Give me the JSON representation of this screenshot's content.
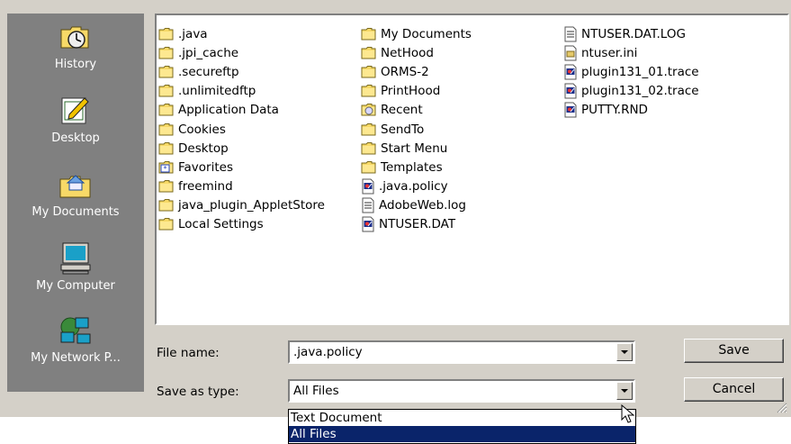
{
  "places": [
    {
      "label": "History",
      "icon": "history-icon"
    },
    {
      "label": "Desktop",
      "icon": "desktop-icon"
    },
    {
      "label": "My Documents",
      "icon": "my-documents-icon"
    },
    {
      "label": "My Computer",
      "icon": "my-computer-icon"
    },
    {
      "label": "My Network P...",
      "icon": "network-places-icon"
    }
  ],
  "files": {
    "col1": [
      {
        "name": ".java",
        "icon": "folder-icon"
      },
      {
        "name": ".jpi_cache",
        "icon": "folder-icon"
      },
      {
        "name": ".secureftp",
        "icon": "folder-icon"
      },
      {
        "name": ".unlimitedftp",
        "icon": "folder-icon"
      },
      {
        "name": "Application Data",
        "icon": "folder-icon"
      },
      {
        "name": "Cookies",
        "icon": "folder-icon"
      },
      {
        "name": "Desktop",
        "icon": "folder-icon"
      },
      {
        "name": "Favorites",
        "icon": "favorites-folder-icon"
      },
      {
        "name": "freemind",
        "icon": "folder-icon"
      },
      {
        "name": "java_plugin_AppletStore",
        "icon": "folder-icon"
      },
      {
        "name": "Local Settings",
        "icon": "folder-icon"
      }
    ],
    "col2": [
      {
        "name": "My Documents",
        "icon": "folder-icon"
      },
      {
        "name": "NetHood",
        "icon": "folder-icon"
      },
      {
        "name": "ORMS-2",
        "icon": "folder-icon"
      },
      {
        "name": "PrintHood",
        "icon": "folder-icon"
      },
      {
        "name": "Recent",
        "icon": "recent-folder-icon"
      },
      {
        "name": "SendTo",
        "icon": "folder-icon"
      },
      {
        "name": "Start Menu",
        "icon": "folder-icon"
      },
      {
        "name": "Templates",
        "icon": "folder-icon"
      },
      {
        "name": ".java.policy",
        "icon": "file-icon"
      },
      {
        "name": "AdobeWeb.log",
        "icon": "text-file-icon"
      },
      {
        "name": "NTUSER.DAT",
        "icon": "file-icon"
      }
    ],
    "col3": [
      {
        "name": "NTUSER.DAT.LOG",
        "icon": "text-file-icon"
      },
      {
        "name": "ntuser.ini",
        "icon": "ini-file-icon"
      },
      {
        "name": "plugin131_01.trace",
        "icon": "file-icon"
      },
      {
        "name": "plugin131_02.trace",
        "icon": "file-icon"
      },
      {
        "name": "PUTTY.RND",
        "icon": "file-icon"
      }
    ]
  },
  "form": {
    "filename_label": "File name:",
    "filename_value": ".java.policy",
    "type_label": "Save as type:",
    "type_value": "All Files",
    "type_options": [
      "Text Document",
      "All Files"
    ],
    "type_selected_index": 1
  },
  "buttons": {
    "save": "Save",
    "cancel": "Cancel"
  },
  "colors": {
    "dialog": "#d4d0c8",
    "places_bar": "#808080",
    "selection": "#0a246a",
    "folder": "#f7d967"
  }
}
